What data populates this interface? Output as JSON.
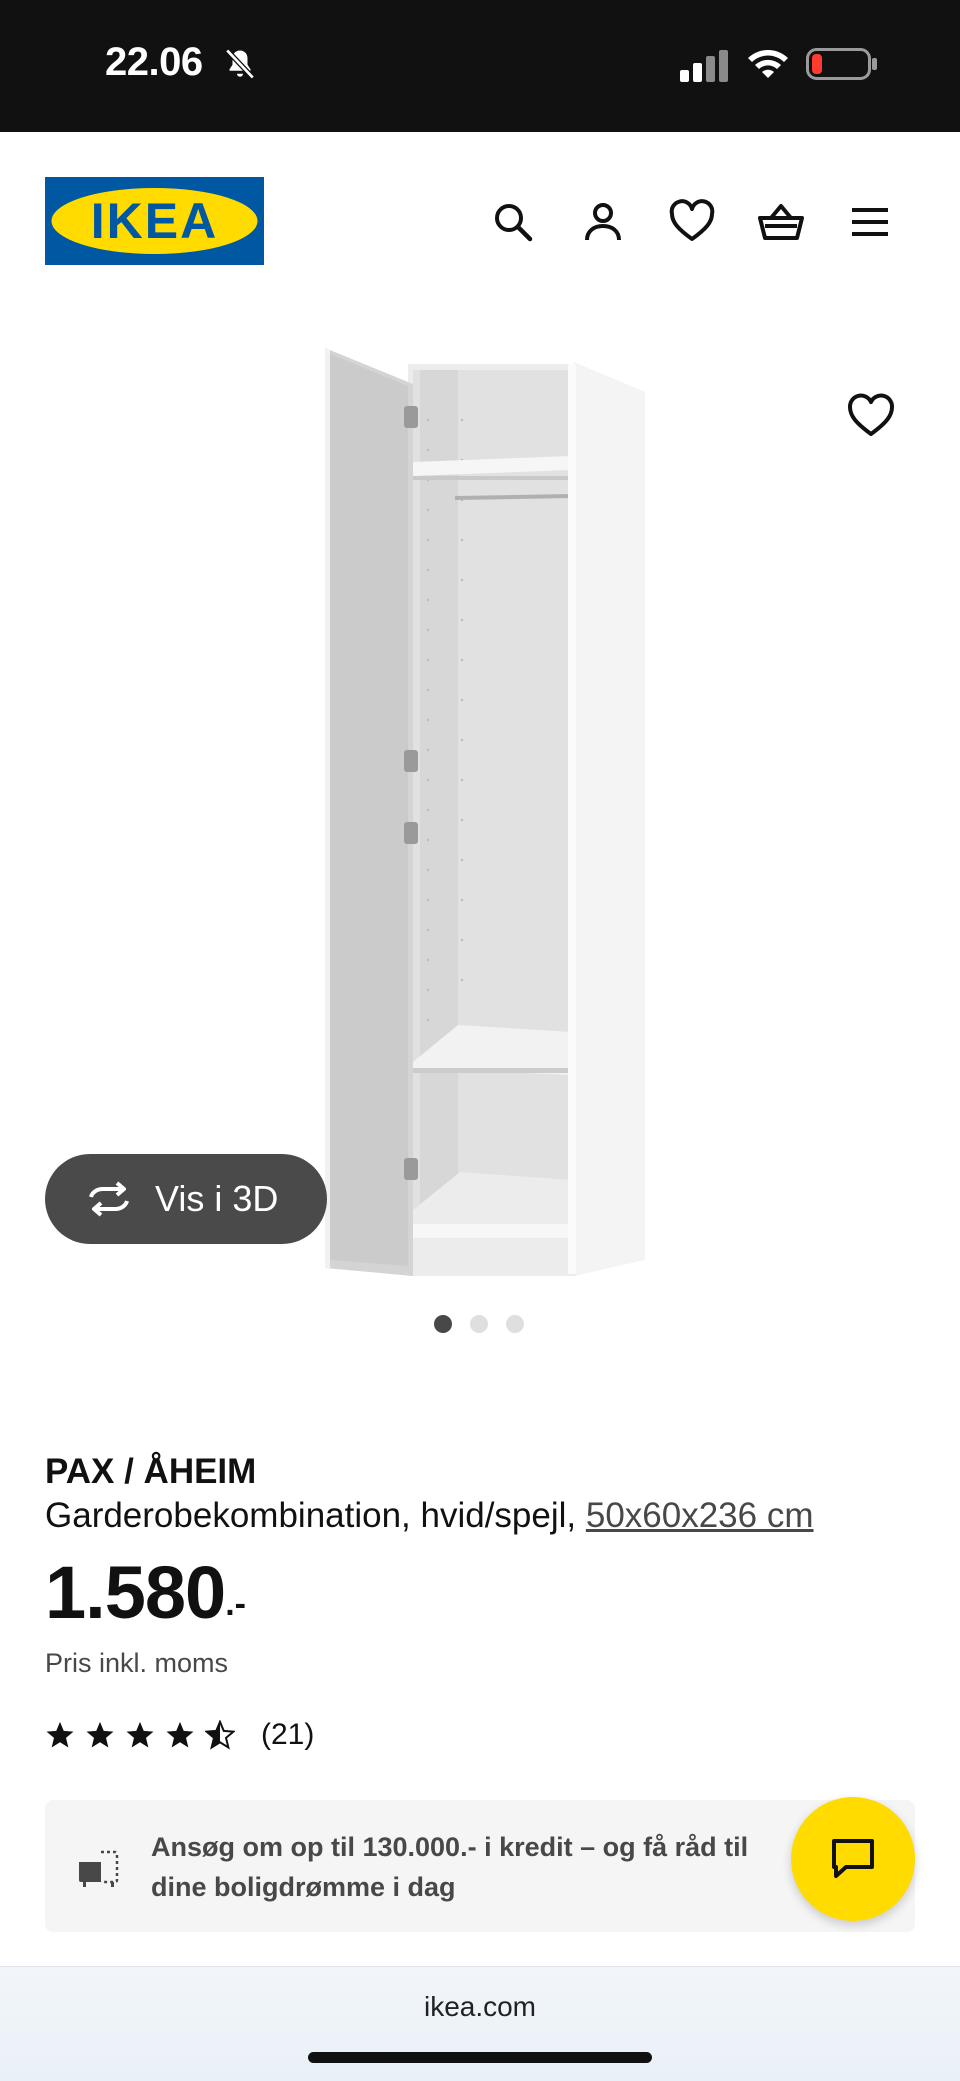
{
  "status_bar": {
    "time": "22.06",
    "icons": [
      "bell-slash-icon",
      "cellular-signal-icon",
      "wifi-icon",
      "battery-low-icon"
    ]
  },
  "header": {
    "logo_text": "IKEA",
    "icons": [
      "search-icon",
      "account-icon",
      "heart-icon",
      "basket-icon",
      "menu-icon"
    ]
  },
  "gallery": {
    "view_3d_label": "Vis i 3D",
    "active_slide": 1,
    "slide_count": 3
  },
  "product": {
    "name": "PAX / ÅHEIM",
    "description": "Garderobekombination, hvid/spejl, ",
    "dimensions": "50x60x236 cm",
    "price": "1.580",
    "price_suffix": ".-",
    "price_note": "Pris inkl. moms",
    "rating_value": 4.5,
    "rating_stars": 5,
    "review_count": "(21)"
  },
  "credit_banner": {
    "text": "Ansøg om op til 130.000.- i kredit – og få råd til dine boligdrømme i dag"
  },
  "browser": {
    "url": "ikea.com"
  },
  "colors": {
    "ikea_blue": "#0058a3",
    "ikea_yellow": "#ffdb00",
    "text": "#111111",
    "muted": "#484848"
  }
}
